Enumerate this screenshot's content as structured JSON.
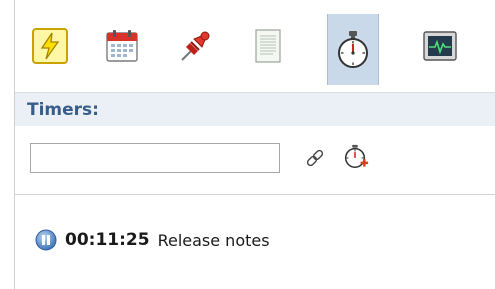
{
  "toolbar": {
    "tools": [
      {
        "icon": "lightning-icon",
        "active": false
      },
      {
        "icon": "calendar-icon",
        "active": false
      },
      {
        "icon": "pushpin-icon",
        "active": false
      },
      {
        "icon": "notes-icon",
        "active": false
      },
      {
        "icon": "stopwatch-icon",
        "active": true
      },
      {
        "icon": "monitor-icon",
        "active": false
      }
    ]
  },
  "header": {
    "title": "Timers:"
  },
  "timer_form": {
    "input_value": "",
    "input_placeholder": "",
    "link_icon": "link-icon",
    "add_timer_icon": "add-timer-icon"
  },
  "timers": [
    {
      "status_icon": "pause-icon",
      "time": "00:11:25",
      "label": "Release notes"
    }
  ],
  "colors": {
    "header_bg": "#eaf0f6",
    "header_text": "#385d8a",
    "active_tab_bg": "#c9d9ea",
    "add_plus": "#e03a1f"
  }
}
